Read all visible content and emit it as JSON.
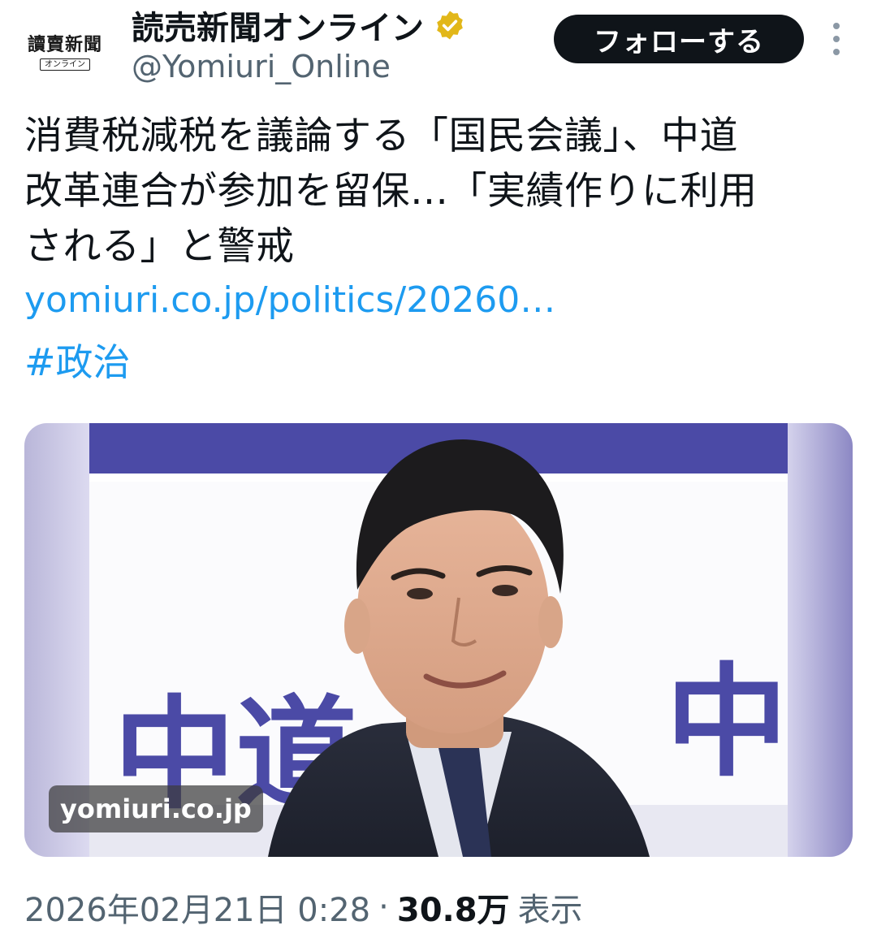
{
  "account": {
    "logo_text": "讀賣新聞",
    "logo_subtext": "オンライン",
    "display_name": "読売新聞オンライン",
    "handle": "@Yomiuri_Online",
    "verified_icon": "verified-badge-icon",
    "follow_label": "フォローする",
    "more_icon": "more-vertical-icon"
  },
  "tweet": {
    "text_lines": [
      "消費税減税を議論する「国民会議」、中道",
      "改革連合が参加を留保…「実績作りに利用",
      "される」と警戒"
    ],
    "link": "yomiuri.co.jp/politics/20260…",
    "hashtag": "#政治"
  },
  "media": {
    "domain_label": "yomiuri.co.jp",
    "banner_text_left": "中道",
    "banner_text_right": "中"
  },
  "meta": {
    "datetime": "2026年02月21日 0:28",
    "separator": "·",
    "views_count": "30.8万",
    "views_label": "表示"
  },
  "colors": {
    "link": "#1d9bf0",
    "verified_gold": "#e2b719",
    "banner_purple": "#4b4aa6"
  }
}
